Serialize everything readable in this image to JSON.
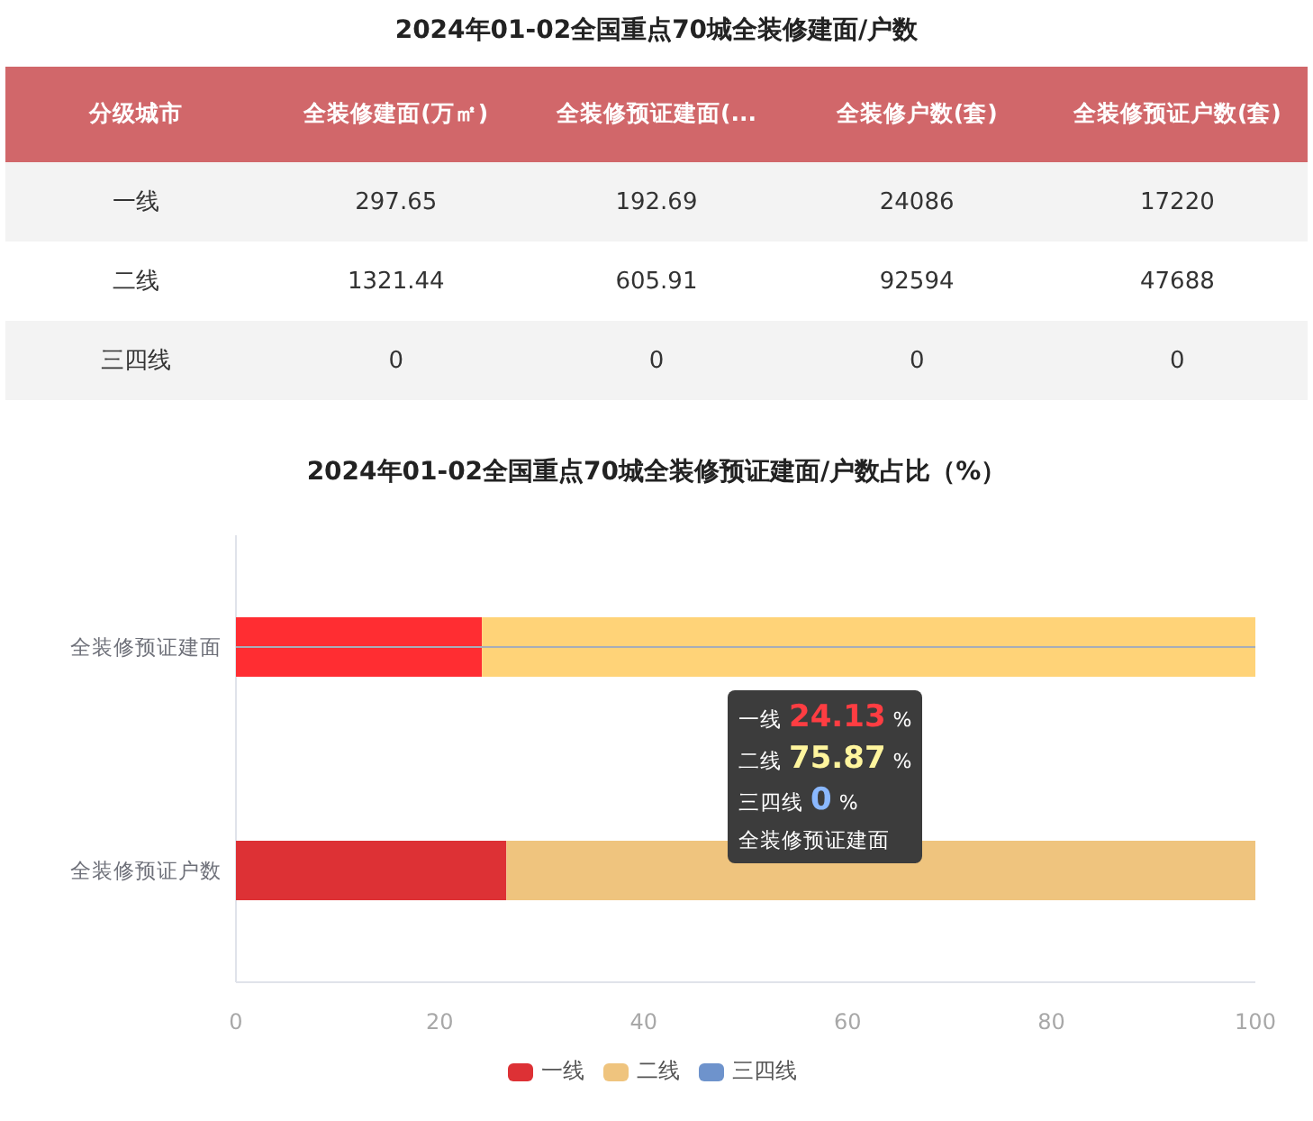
{
  "title": "2024年01-02全国重点70城全装修建面/户数",
  "table": {
    "columns": [
      "分级城市",
      "全装修建面(万㎡)",
      "全装修预证建面(...",
      "全装修户数(套)",
      "全装修预证户数(套)"
    ],
    "rows": [
      [
        "一线",
        "297.65",
        "192.69",
        "24086",
        "17220"
      ],
      [
        "二线",
        "1321.44",
        "605.91",
        "92594",
        "47688"
      ],
      [
        "三四线",
        "0",
        "0",
        "0",
        "0"
      ]
    ]
  },
  "chart": {
    "chart_data": {
      "type": "bar",
      "title": "2024年01-02全国重点70城全装修预证建面/户数占比（%）",
      "orientation": "horizontal",
      "stacked": true,
      "categories": [
        "全装修预证建面",
        "全装修预证户数"
      ],
      "series": [
        {
          "name": "一线",
          "color": "#dd3135",
          "values": [
            24.13,
            26.53
          ]
        },
        {
          "name": "二线",
          "color": "#efc47e",
          "values": [
            75.87,
            73.47
          ]
        },
        {
          "name": "三四线",
          "color": "#6e93cc",
          "values": [
            0,
            0
          ]
        }
      ],
      "xlim": [
        0,
        100
      ],
      "xticks": [
        0,
        20,
        40,
        60,
        80,
        100
      ],
      "legend": true,
      "ref_lines": [
        {
          "axis": "y",
          "value": "全装修预证建面"
        }
      ]
    },
    "tooltip": {
      "visible": true,
      "category": "全装修预证建面",
      "rows": [
        {
          "label": "一线",
          "value": "24.13",
          "unit": "%"
        },
        {
          "label": "二线",
          "value": "75.87",
          "unit": "%"
        },
        {
          "label": "三四线",
          "value": "0",
          "unit": "%"
        }
      ]
    }
  }
}
